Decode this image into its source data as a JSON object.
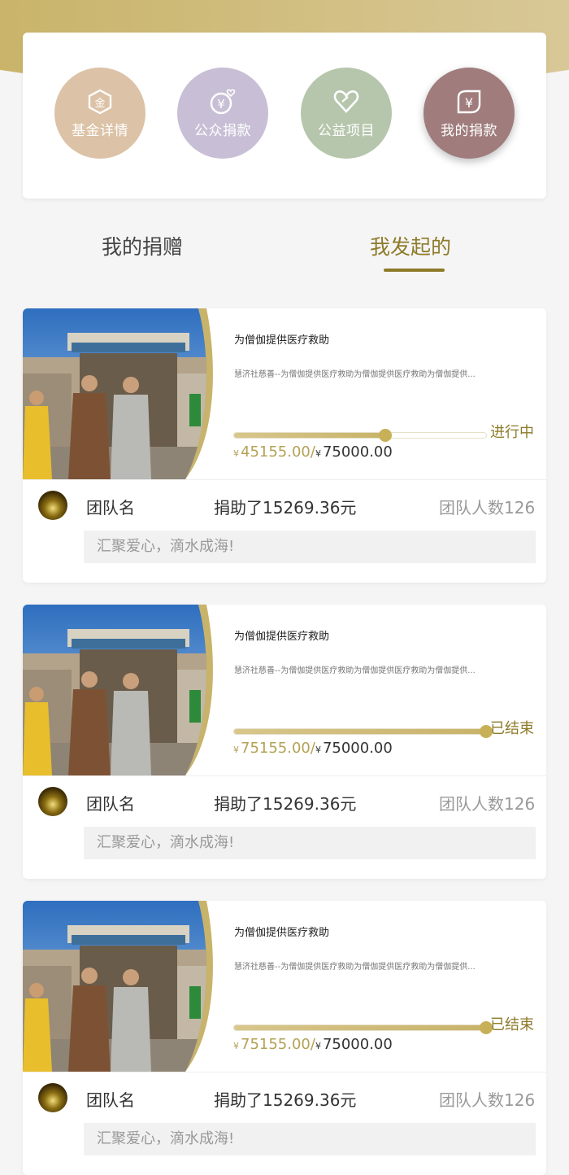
{
  "nav": {
    "items": [
      {
        "label": "基金详情",
        "icon": "gold-badge-icon",
        "color": "#dcc2a6"
      },
      {
        "label": "公众捐款",
        "icon": "yen-heart-icon",
        "color": "#c8bfd6"
      },
      {
        "label": "公益项目",
        "icon": "heart-icon",
        "color": "#b6c6ac"
      },
      {
        "label": "我的捐款",
        "icon": "yen-leaf-icon",
        "color": "#a07c7c"
      }
    ]
  },
  "tabs": {
    "my_donations": "我的捐赠",
    "my_initiated": "我发起的"
  },
  "colors": {
    "accent": "#8d7b2a",
    "gold": "#c7b057"
  },
  "projects": [
    {
      "title": "为僧伽提供医疗救助",
      "description": "慧济社慈善--为僧伽提供医疗救助为僧伽提供医疗救助为僧伽提供...",
      "status": "进行中",
      "progress": 0.6,
      "currency": "¥",
      "raised": "45155.00/",
      "target": "75000.00",
      "team": "团队名",
      "donated": "捐助了15269.36元",
      "members": "团队人数126",
      "slogan": "汇聚爱心，滴水成海!"
    },
    {
      "title": "为僧伽提供医疗救助",
      "description": "慧济社慈善--为僧伽提供医疗救助为僧伽提供医疗救助为僧伽提供...",
      "status": "已结束",
      "progress": 1.0,
      "currency": "¥",
      "raised": "75155.00/",
      "target": "75000.00",
      "team": "团队名",
      "donated": "捐助了15269.36元",
      "members": "团队人数126",
      "slogan": "汇聚爱心，滴水成海!"
    },
    {
      "title": "为僧伽提供医疗救助",
      "description": "慧济社慈善--为僧伽提供医疗救助为僧伽提供医疗救助为僧伽提供...",
      "status": "已结束",
      "progress": 1.0,
      "currency": "¥",
      "raised": "75155.00/",
      "target": "75000.00",
      "team": "团队名",
      "donated": "捐助了15269.36元",
      "members": "团队人数126",
      "slogan": "汇聚爱心，滴水成海!"
    }
  ]
}
